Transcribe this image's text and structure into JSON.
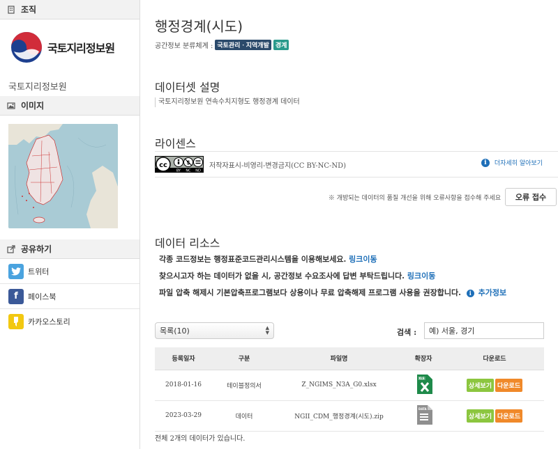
{
  "colors": {
    "badge_land": "#2b4a6b",
    "badge_boundary": "#2a9a8c",
    "link": "#1e6fb8",
    "detail_btn": "#8cc63f",
    "download_btn": "#f0892a",
    "twitter": "#4aa3df",
    "facebook": "#3b5998",
    "kakaostory": "#f2c811"
  },
  "sidebar": {
    "org_header": "조직",
    "org_logo_text": "국토지리정보원",
    "org_name": "국토지리정보원",
    "image_header": "이미지",
    "share_header": "공유하기",
    "share_items": [
      {
        "label": "트위터",
        "icon": "twitter-icon"
      },
      {
        "label": "페이스북",
        "icon": "facebook-icon"
      },
      {
        "label": "카카오스토리",
        "icon": "kakaostory-icon"
      }
    ]
  },
  "main": {
    "title": "행정경계(시도)",
    "category_label": "공간정보 분류체계 :",
    "category_badges": [
      "국토관리ㆍ지역개발",
      "경계"
    ],
    "description_title": "데이터셋 설명",
    "description": "국토지리정보원 연속수치지형도 행정경계 데이터",
    "license_title": "라이센스",
    "license_text": "저작자표시-비영리-변경금지(CC BY-NC-ND)",
    "license_more": "더자세히 알아보기",
    "error_note": "※ 개방되는 데이터의 품질 개선을 위해 오류사항을 접수해 주세요",
    "error_button": "오류 접수",
    "resources_title": "데이터 리소스",
    "notice_1": "각종 코드정보는 행정표준코드관리시스템을 이용해보세요.",
    "notice_1_link": "링크이동",
    "notice_2": "찾으시고자 하는 데이터가 없을 시, 공간정보 수요조사에 답변 부탁드립니다.",
    "notice_2_link": "링크이동",
    "notice_3": "파일 압축 해제시 기본압축프로그램보다 상용이나 무료 압축해제 프로그램 사용을 권장합니다.",
    "notice_3_link": "추가정보",
    "page_size": "목록(10)",
    "search_label": "검색 :",
    "search_placeholder": "예) 서울, 경기",
    "table_headers": [
      "등록일자",
      "구분",
      "파일명",
      "확장자",
      "다운로드"
    ],
    "rows": [
      {
        "date": "2018-01-16",
        "type": "테이블정의서",
        "file": "Z_NGIMS_N3A_G0.xlsx",
        "ext_icon": "excel-file-icon",
        "ext_tag": "XLS",
        "detail": "상세보기",
        "download": "다운로드"
      },
      {
        "date": "2023-03-29",
        "type": "데이터",
        "file": "NGII_CDM_행정경계(시도).zip",
        "ext_icon": "data-file-icon",
        "ext_tag": "DATA",
        "detail": "상세보기",
        "download": "다운로드"
      }
    ],
    "total": "전체 2개의 데이터가 있습니다."
  }
}
